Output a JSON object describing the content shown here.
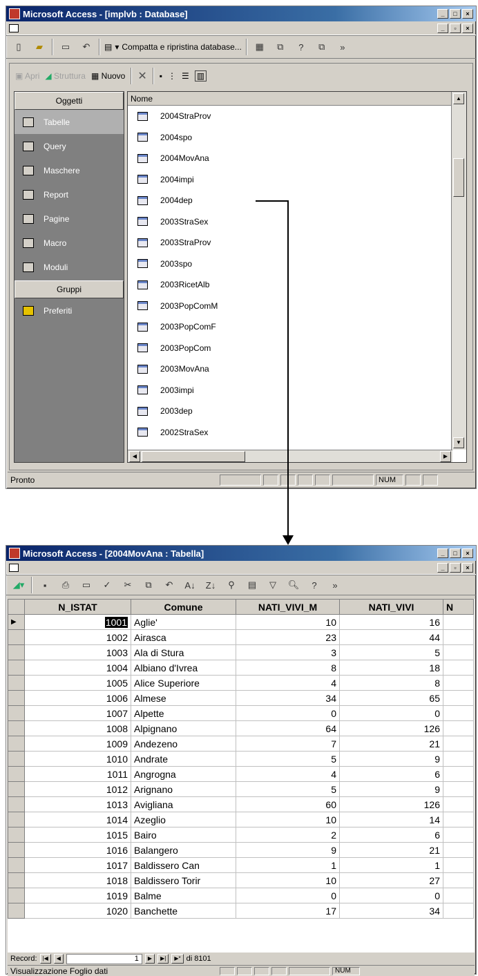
{
  "top_window": {
    "title": "Microsoft Access - [implvb : Database]",
    "toolbar": {
      "compact_label": "Compatta e ripristina database...",
      "chevron": "»"
    },
    "inner_toolbar": {
      "open": "Apri",
      "design": "Struttura",
      "new": "Nuovo"
    },
    "objects_header": "Oggetti",
    "objects": [
      "Tabelle",
      "Query",
      "Maschere",
      "Report",
      "Pagine",
      "Macro",
      "Moduli"
    ],
    "groups_header": "Gruppi",
    "groups": [
      "Preferiti"
    ],
    "list_header": "Nome",
    "tables": [
      "2004StraProv",
      "2004spo",
      "2004MovAna",
      "2004impi",
      "2004dep",
      "2003StraSex",
      "2003StraProv",
      "2003spo",
      "2003RicetAlb",
      "2003PopComM",
      "2003PopComF",
      "2003PopCom",
      "2003MovAna",
      "2003impi",
      "2003dep",
      "2002StraSex"
    ],
    "status": "Pronto",
    "num": "NUM"
  },
  "bottom_window": {
    "title": "Microsoft Access - [2004MovAna : Tabella]",
    "chevron": "»",
    "columns": [
      "N_ISTAT",
      "Comune",
      "NATI_VIVI_M",
      "NATI_VIVI",
      "N"
    ],
    "rows": [
      [
        "1001",
        "Aglie'",
        "10",
        "16"
      ],
      [
        "1002",
        "Airasca",
        "23",
        "44"
      ],
      [
        "1003",
        "Ala di Stura",
        "3",
        "5"
      ],
      [
        "1004",
        "Albiano d'Ivrea",
        "8",
        "18"
      ],
      [
        "1005",
        "Alice Superiore",
        "4",
        "8"
      ],
      [
        "1006",
        "Almese",
        "34",
        "65"
      ],
      [
        "1007",
        "Alpette",
        "0",
        "0"
      ],
      [
        "1008",
        "Alpignano",
        "64",
        "126"
      ],
      [
        "1009",
        "Andezeno",
        "7",
        "21"
      ],
      [
        "1010",
        "Andrate",
        "5",
        "9"
      ],
      [
        "1011",
        "Angrogna",
        "4",
        "6"
      ],
      [
        "1012",
        "Arignano",
        "5",
        "9"
      ],
      [
        "1013",
        "Avigliana",
        "60",
        "126"
      ],
      [
        "1014",
        "Azeglio",
        "10",
        "14"
      ],
      [
        "1015",
        "Bairo",
        "2",
        "6"
      ],
      [
        "1016",
        "Balangero",
        "9",
        "21"
      ],
      [
        "1017",
        "Baldissero Can",
        "1",
        "1"
      ],
      [
        "1018",
        "Baldissero Torir",
        "10",
        "27"
      ],
      [
        "1019",
        "Balme",
        "0",
        "0"
      ],
      [
        "1020",
        "Banchette",
        "17",
        "34"
      ]
    ],
    "nav": {
      "label": "Record:",
      "current": "1",
      "total": "di 8101"
    },
    "status": "Visualizzazione Foglio dati",
    "num": "NUM"
  }
}
